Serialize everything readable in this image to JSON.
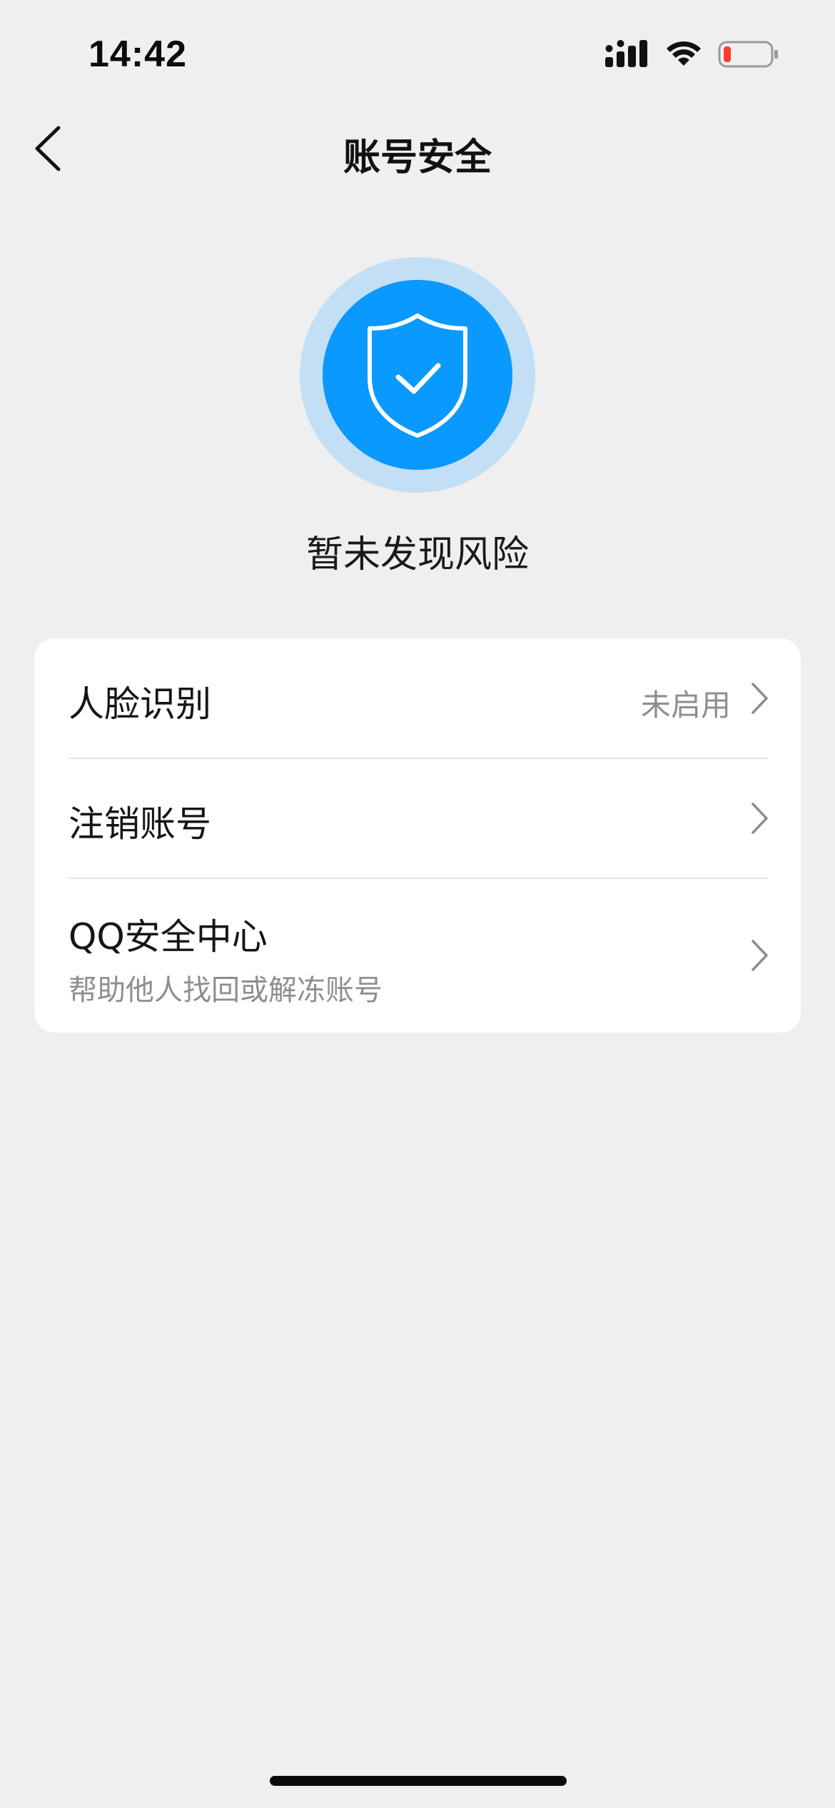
{
  "status_bar": {
    "time": "14:42",
    "icons": [
      "signal-icon",
      "wifi-icon",
      "battery-low-icon"
    ],
    "battery_color": "#ff3b30"
  },
  "nav": {
    "title": "账号安全",
    "back_icon": "chevron-left-icon"
  },
  "security_status": {
    "icon": "shield-check-icon",
    "text": "暂未发现风险",
    "accent_color": "#0a99ff",
    "halo_color": "#c3dff5"
  },
  "settings": {
    "rows": [
      {
        "label": "人脸识别",
        "value": "未启用"
      },
      {
        "label": "注销账号"
      },
      {
        "label": "QQ安全中心",
        "subtitle": "帮助他人找回或解冻账号"
      }
    ]
  }
}
